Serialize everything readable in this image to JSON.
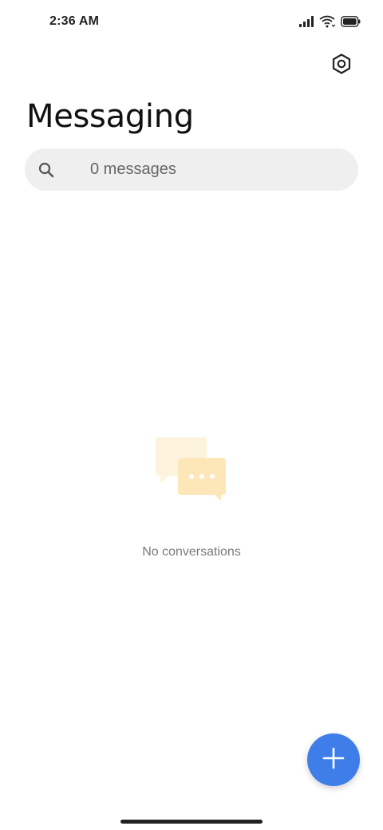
{
  "status_bar": {
    "time": "2:36 AM",
    "icons": [
      "signal-icon",
      "wifi-icon",
      "battery-icon"
    ]
  },
  "header": {
    "settings_icon": "gear-icon"
  },
  "page": {
    "title": "Messaging"
  },
  "search": {
    "placeholder": "0 messages",
    "icon": "search-icon"
  },
  "empty_state": {
    "illustration": "chat-bubbles-icon",
    "text": "No conversations"
  },
  "fab": {
    "icon": "plus-icon",
    "color": "#3f7ee8"
  },
  "colors": {
    "accent": "#3f7ee8",
    "search_bg": "#efefef",
    "illustration_light": "#fdf3dc",
    "illustration_dark": "#fde7b8"
  }
}
